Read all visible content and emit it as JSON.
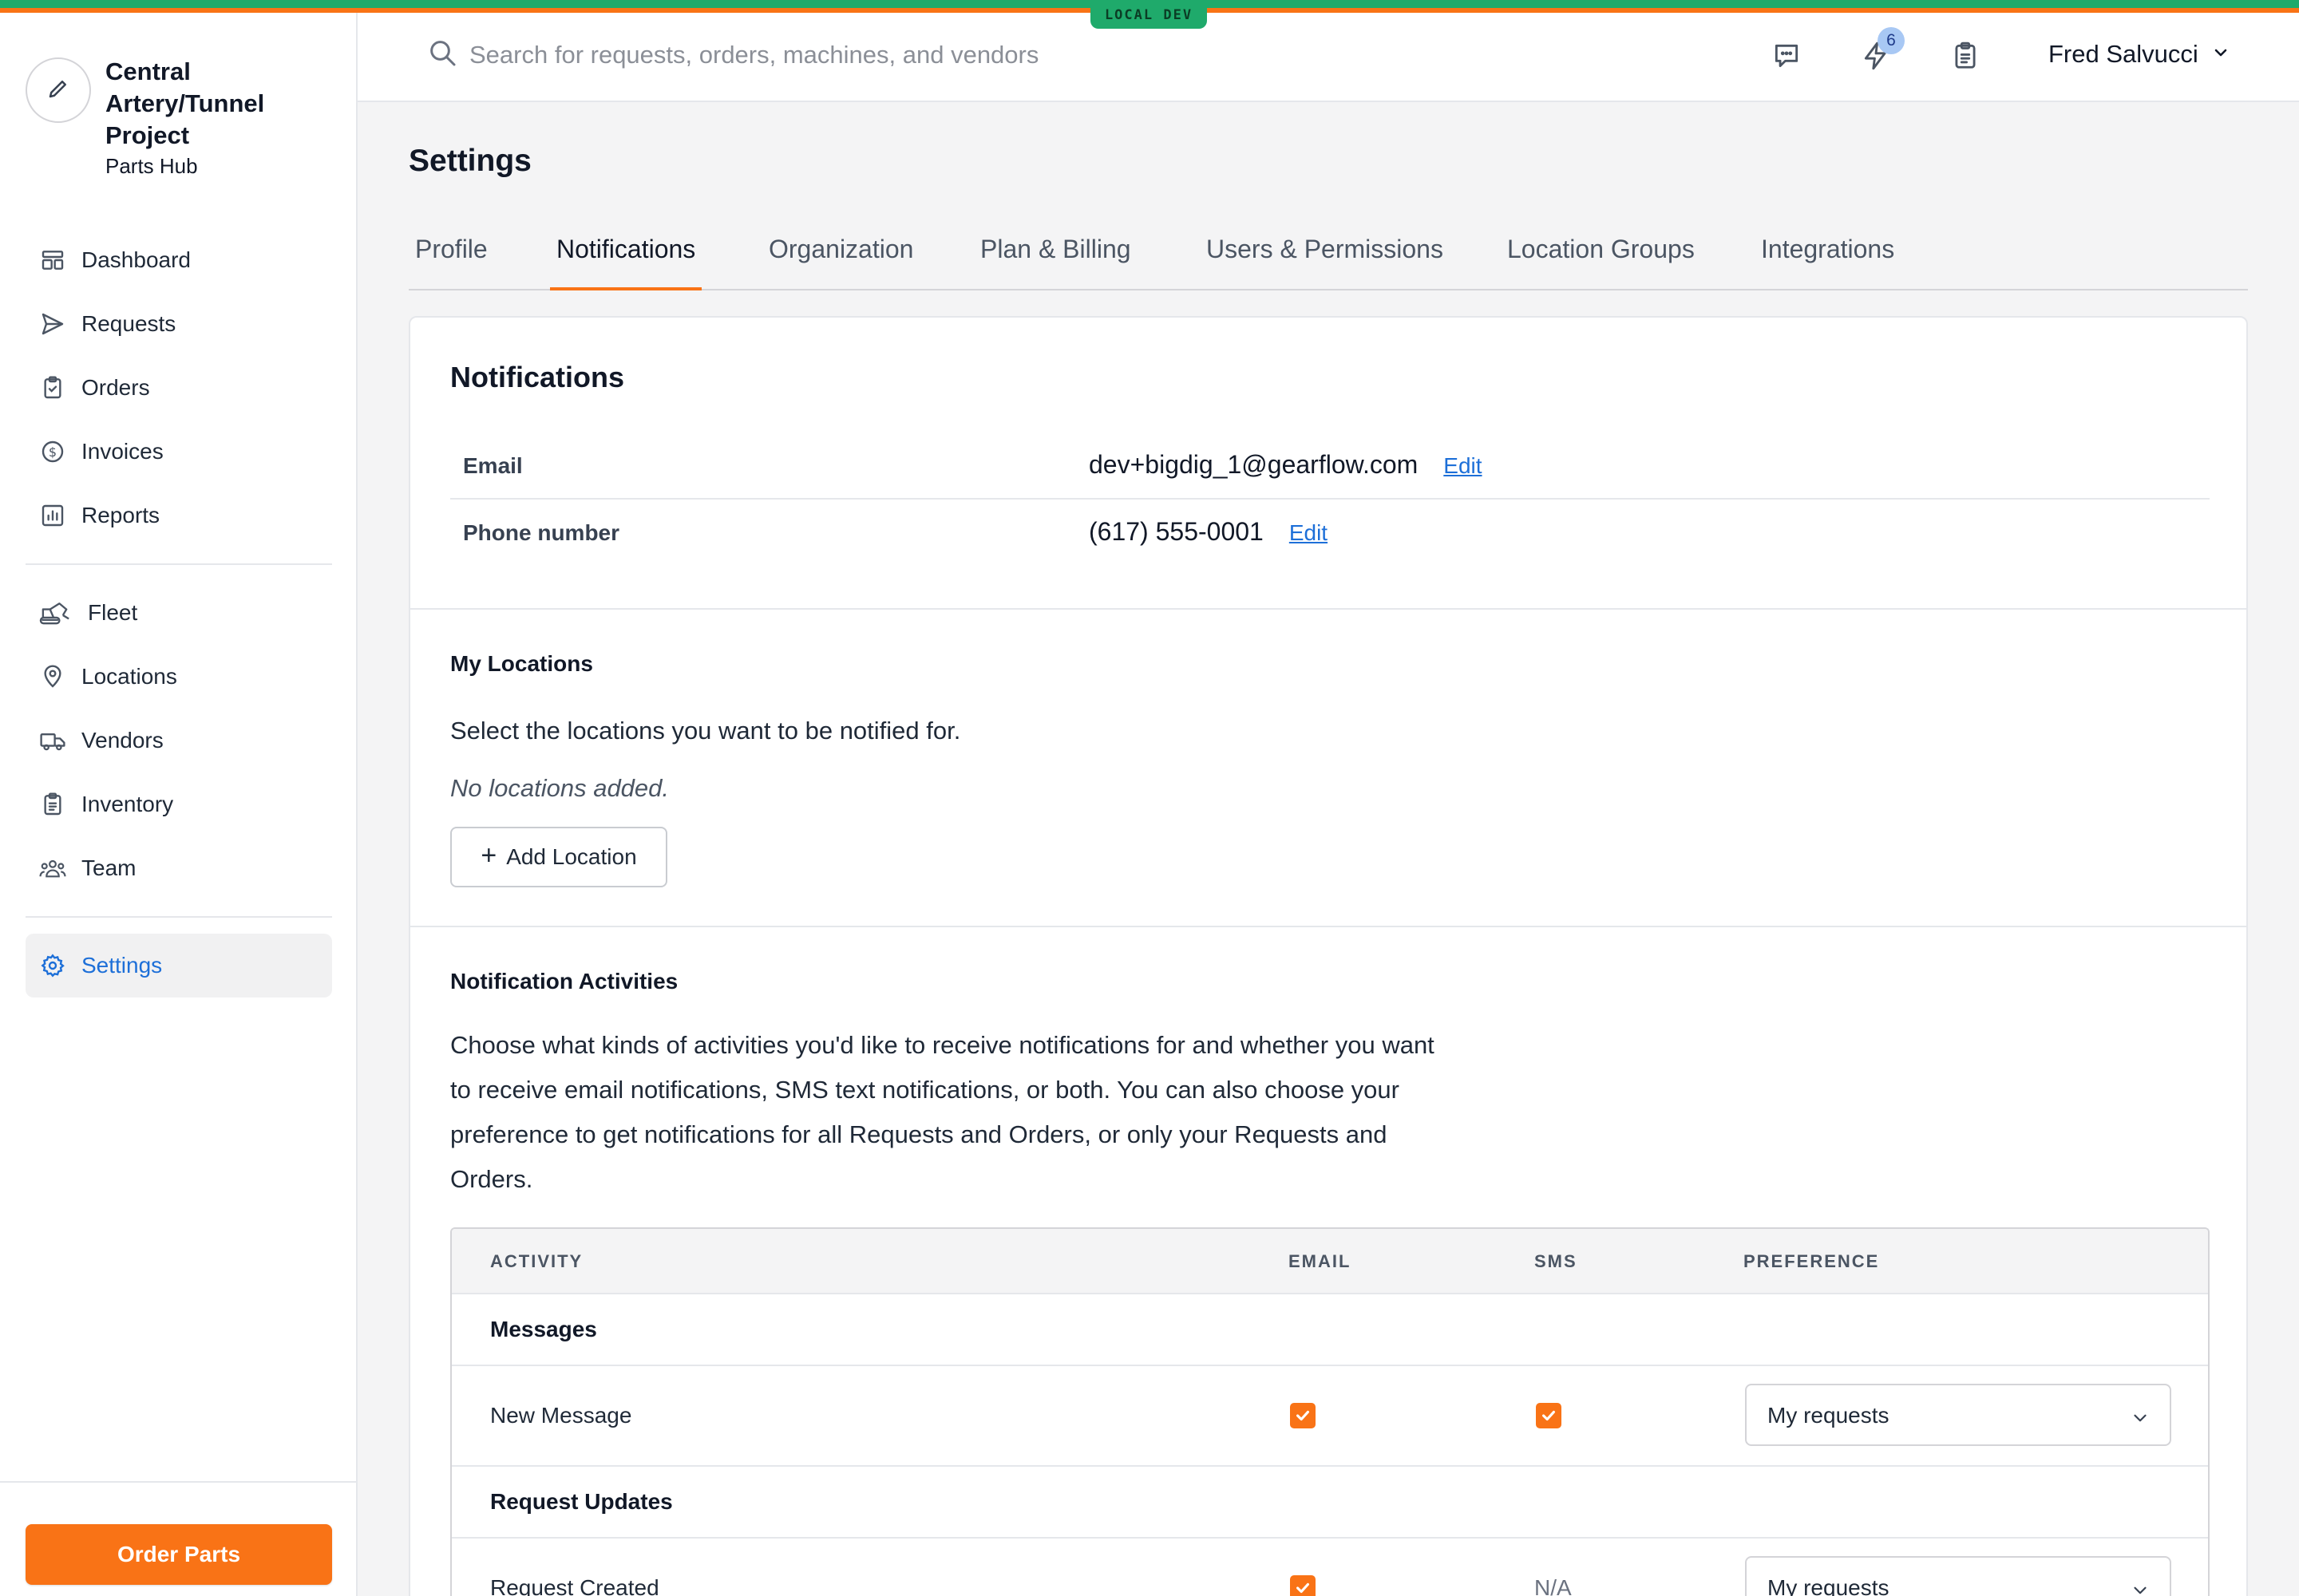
{
  "env_badge": "LOCAL DEV",
  "org": {
    "name": "Central Artery/Tunnel Project",
    "subtitle": "Parts Hub"
  },
  "sidebar": {
    "primary": [
      {
        "label": "Dashboard",
        "icon": "dashboard-icon"
      },
      {
        "label": "Requests",
        "icon": "paper-plane-icon"
      },
      {
        "label": "Orders",
        "icon": "clipboard-check-icon"
      },
      {
        "label": "Invoices",
        "icon": "dollar-circle-icon"
      },
      {
        "label": "Reports",
        "icon": "bar-chart-icon"
      }
    ],
    "secondary": [
      {
        "label": "Fleet",
        "icon": "excavator-icon"
      },
      {
        "label": "Locations",
        "icon": "map-pin-icon"
      },
      {
        "label": "Vendors",
        "icon": "truck-icon"
      },
      {
        "label": "Inventory",
        "icon": "clipboard-list-icon"
      },
      {
        "label": "Team",
        "icon": "team-icon"
      }
    ],
    "settings": {
      "label": "Settings",
      "icon": "gear-icon",
      "active": true
    },
    "order_button": "Order Parts"
  },
  "header": {
    "search_placeholder": "Search for requests, orders, machines, and vendors",
    "notification_count": "6",
    "user_name": "Fred Salvucci"
  },
  "page_title": "Settings",
  "tabs": [
    "Profile",
    "Notifications",
    "Organization",
    "Plan & Billing",
    "Users & Permissions",
    "Location Groups",
    "Integrations"
  ],
  "active_tab": "Notifications",
  "notifications": {
    "title": "Notifications",
    "email": {
      "label": "Email",
      "value": "dev+bigdig_1@gearflow.com",
      "edit": "Edit"
    },
    "phone": {
      "label": "Phone number",
      "value": "(617) 555-0001",
      "edit": "Edit"
    }
  },
  "my_locations": {
    "title": "My Locations",
    "description": "Select the locations you want to be notified for.",
    "empty": "No locations added.",
    "add_button": "Add Location"
  },
  "activities": {
    "title": "Notification Activities",
    "description": "Choose what kinds of activities you'd like to receive notifications for and whether you want to receive email notifications, SMS text notifications, or both. You can also choose your preference to get notifications for all Requests and Orders, or only your Requests and Orders.",
    "columns": [
      "ACTIVITY",
      "EMAIL",
      "SMS",
      "PREFERENCE"
    ],
    "groups": [
      {
        "name": "Messages",
        "rows": [
          {
            "activity": "New Message",
            "email": true,
            "sms": true,
            "sms_text": "",
            "preference": "My requests"
          }
        ]
      },
      {
        "name": "Request Updates",
        "rows": [
          {
            "activity": "Request Created",
            "email": true,
            "sms": false,
            "sms_text": "N/A",
            "preference": "My requests"
          }
        ]
      }
    ]
  },
  "colors": {
    "accent": "#f97316",
    "link": "#1d6fd8",
    "env_green": "#1faa6b"
  }
}
